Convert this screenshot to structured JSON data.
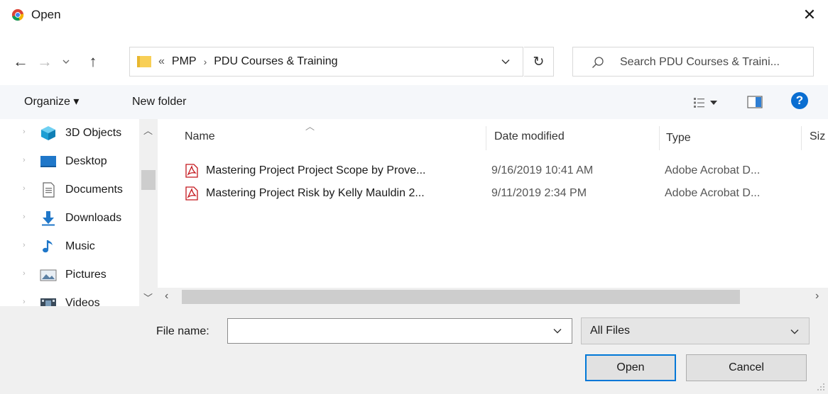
{
  "window": {
    "title": "Open",
    "close_label": "✕"
  },
  "address": {
    "overflow": "«",
    "crumbs": [
      "PMP",
      "PDU Courses & Training"
    ],
    "separator": "›"
  },
  "search": {
    "placeholder": "Search PDU Courses & Traini..."
  },
  "toolbar": {
    "organize": "Organize ▾",
    "new_folder": "New folder"
  },
  "nav": {
    "items": [
      {
        "label": "3D Objects",
        "icon": "3d-objects-icon"
      },
      {
        "label": "Desktop",
        "icon": "desktop-icon"
      },
      {
        "label": "Documents",
        "icon": "documents-icon"
      },
      {
        "label": "Downloads",
        "icon": "downloads-icon"
      },
      {
        "label": "Music",
        "icon": "music-icon"
      },
      {
        "label": "Pictures",
        "icon": "pictures-icon"
      },
      {
        "label": "Videos",
        "icon": "videos-icon"
      }
    ]
  },
  "files": {
    "columns": {
      "name": "Name",
      "date": "Date modified",
      "type": "Type",
      "size": "Siz"
    },
    "rows": [
      {
        "name": "Mastering Project Project Scope by Prove...",
        "date": "9/16/2019 10:41 AM",
        "type": "Adobe Acrobat D..."
      },
      {
        "name": "Mastering Project Risk by Kelly Mauldin 2...",
        "date": "9/11/2019 2:34 PM",
        "type": "Adobe Acrobat D..."
      }
    ]
  },
  "bottom": {
    "file_name_label": "File name:",
    "file_name_value": "",
    "filter": "All Files",
    "open_label": "Open",
    "cancel_label": "Cancel"
  },
  "colors": {
    "accent": "#0078d7",
    "help": "#0a6ed1",
    "folder": "#f8cf56",
    "pdf": "#c4161c"
  }
}
